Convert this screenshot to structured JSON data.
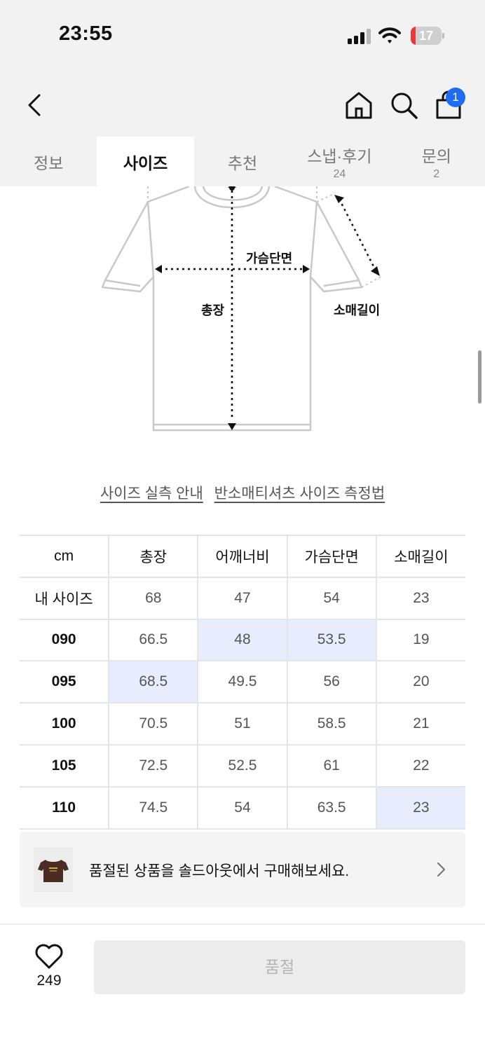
{
  "status_bar": {
    "time": "23:55",
    "battery_level": "17",
    "battery_fraction": 0.17,
    "battery_color": "#e8393d"
  },
  "header": {
    "back_icon": "chevron-left-icon",
    "home_icon": "home-icon",
    "search_icon": "search-icon",
    "cart_icon": "shopping-bag-icon",
    "cart_badge": "1",
    "badge_color": "#1f6bf2"
  },
  "tabs": [
    {
      "label": "정보",
      "count": ""
    },
    {
      "label": "사이즈",
      "count": ""
    },
    {
      "label": "추천",
      "count": ""
    },
    {
      "label": "스냅·후기",
      "count": "24"
    },
    {
      "label": "문의",
      "count": "2"
    }
  ],
  "active_tab": "사이즈",
  "diagram": {
    "chest_label": "가슴단면",
    "length_label": "총장",
    "sleeve_label": "소매길이"
  },
  "links": {
    "guide": "사이즈 실측 안내",
    "measure": "반소매티셔츠 사이즈 측정법"
  },
  "size_table": {
    "headers": [
      "cm",
      "총장",
      "어깨너비",
      "가슴단면",
      "소매길이"
    ],
    "rows": [
      [
        "내 사이즈",
        "68",
        "47",
        "54",
        "23"
      ],
      [
        "090",
        "66.5",
        "48",
        "53.5",
        "19"
      ],
      [
        "095",
        "68.5",
        "49.5",
        "56",
        "20"
      ],
      [
        "100",
        "70.5",
        "51",
        "58.5",
        "21"
      ],
      [
        "105",
        "72.5",
        "52.5",
        "61",
        "22"
      ],
      [
        "110",
        "74.5",
        "54",
        "63.5",
        "23"
      ]
    ],
    "highlight_color": "#e8edfd"
  },
  "sold_banner": {
    "text": "품절된 상품을 솔드아웃에서 구매해보세요.",
    "chevron_icon": "chevron-right-icon"
  },
  "bottom_bar": {
    "like_icon": "heart-icon",
    "like_count": "249",
    "buy_label": "품절"
  }
}
